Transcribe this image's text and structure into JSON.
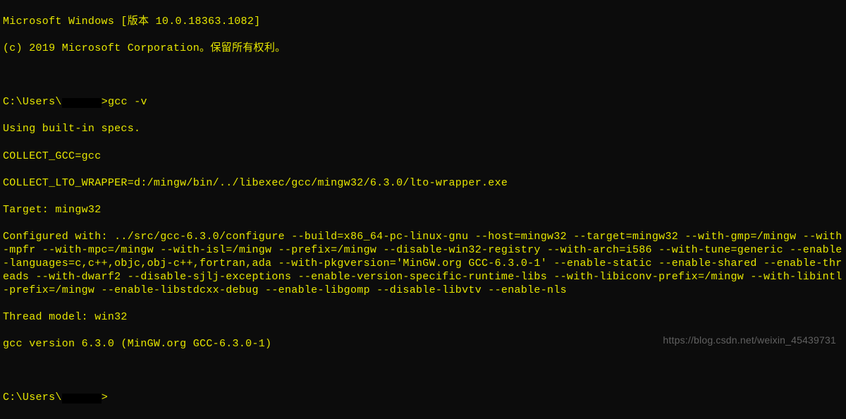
{
  "header": {
    "version_line": "Microsoft Windows [版本 10.0.18363.1082]",
    "copyright_line": "(c) 2019 Microsoft Corporation。保留所有权利。"
  },
  "prompt1": {
    "prefix": "C:\\Users\\",
    "suffix": ">",
    "command": "gcc -v"
  },
  "output": {
    "using_specs": "Using built-in specs.",
    "collect_gcc": "COLLECT_GCC=gcc",
    "collect_lto": "COLLECT_LTO_WRAPPER=d:/mingw/bin/../libexec/gcc/mingw32/6.3.0/lto-wrapper.exe",
    "target": "Target: mingw32",
    "configured": "Configured with: ../src/gcc-6.3.0/configure --build=x86_64-pc-linux-gnu --host=mingw32 --target=mingw32 --with-gmp=/mingw --with-mpfr --with-mpc=/mingw --with-isl=/mingw --prefix=/mingw --disable-win32-registry --with-arch=i586 --with-tune=generic --enable-languages=c,c++,objc,obj-c++,fortran,ada --with-pkgversion='MinGW.org GCC-6.3.0-1' --enable-static --enable-shared --enable-threads --with-dwarf2 --disable-sjlj-exceptions --enable-version-specific-runtime-libs --with-libiconv-prefix=/mingw --with-libintl-prefix=/mingw --enable-libstdcxx-debug --enable-libgomp --disable-libvtv --enable-nls",
    "thread_model": "Thread model: win32",
    "gcc_version": "gcc version 6.3.0 (MinGW.org GCC-6.3.0-1)"
  },
  "prompt2": {
    "prefix": "C:\\Users\\",
    "suffix": ">"
  },
  "watermark": "https://blog.csdn.net/weixin_45439731"
}
